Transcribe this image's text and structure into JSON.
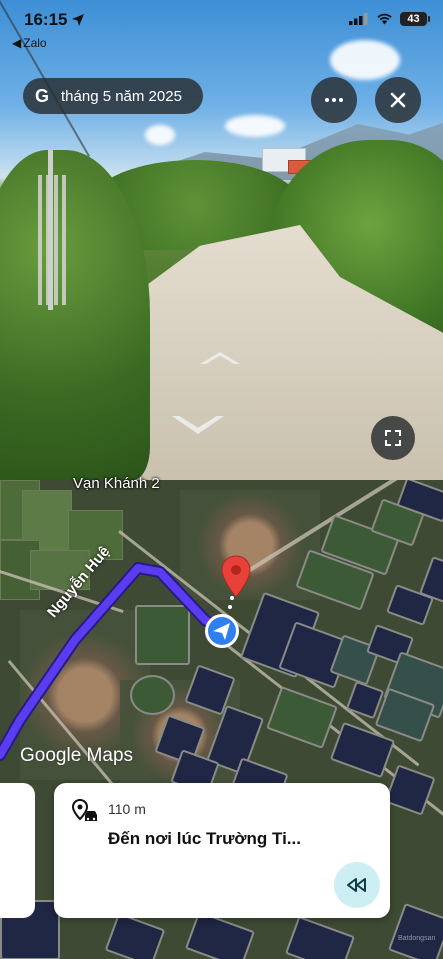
{
  "status_bar": {
    "time": "16:15",
    "back_app": "Zalo",
    "battery": "43"
  },
  "street_view": {
    "date": "tháng 5 năm 2025",
    "more_icon": "more-horizontal-icon",
    "close_icon": "close-icon",
    "fullscreen_icon": "fullscreen-icon"
  },
  "map": {
    "place_label": "Vạn Khánh 2",
    "road_label": "Nguyễn Huệ",
    "brand": "Google Maps",
    "route_color": "#5a3df0",
    "pin_color": "#e8413a"
  },
  "navigation": {
    "distance": "110 m",
    "instruction": "Đến nơi lúc Trường Ti..."
  }
}
